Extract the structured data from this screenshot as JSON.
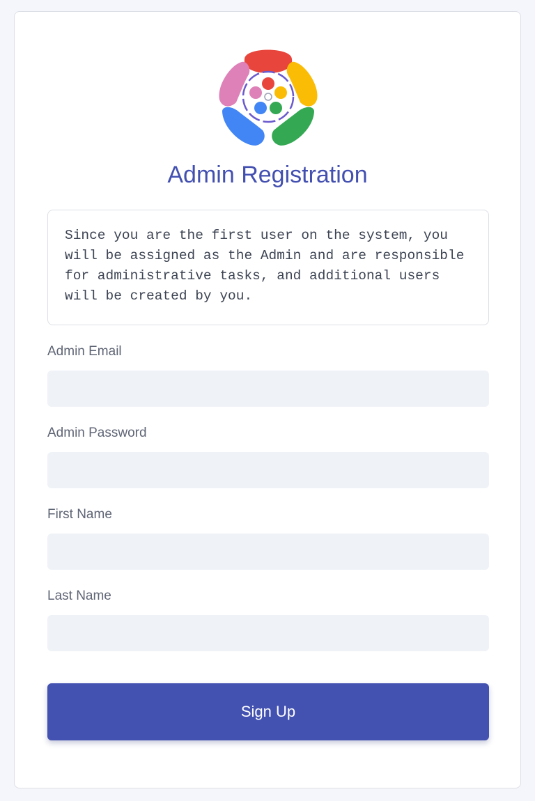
{
  "logo": {
    "icon": "multicolor-flower-logo-icon",
    "colors": {
      "red": "#e8453c",
      "yellow": "#fbbc05",
      "green": "#34a853",
      "blue": "#4285f4",
      "pink": "#de81b8"
    }
  },
  "title": "Admin Registration",
  "notice": "Since you are the first user on the system, you will be assigned as the Admin and are responsible for administrative tasks, and additional users will be created by you.",
  "fields": {
    "email": {
      "label": "Admin Email",
      "value": "",
      "placeholder": ""
    },
    "password": {
      "label": "Admin Password",
      "value": "",
      "placeholder": ""
    },
    "first_name": {
      "label": "First Name",
      "value": "",
      "placeholder": ""
    },
    "last_name": {
      "label": "Last Name",
      "value": "",
      "placeholder": ""
    }
  },
  "submit_label": "Sign Up",
  "colors": {
    "accent": "#4351b0",
    "title": "#4350b0",
    "input_bg": "#eff2f7",
    "page_bg": "#f5f6fb"
  }
}
